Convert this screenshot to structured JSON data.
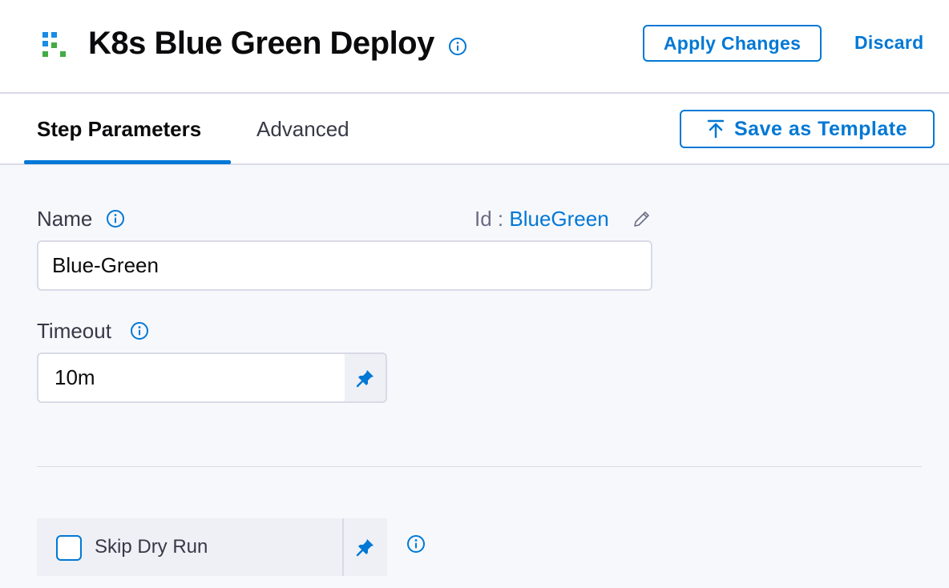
{
  "header": {
    "title": "K8s Blue Green Deploy",
    "apply_label": "Apply Changes",
    "discard_label": "Discard",
    "logo_icon": "k8s-step-logo-icon"
  },
  "tabs": [
    {
      "label": "Step Parameters",
      "active": true
    },
    {
      "label": "Advanced",
      "active": false
    }
  ],
  "template_button": {
    "label": "Save as Template",
    "icon": "upload-icon"
  },
  "form": {
    "name": {
      "label": "Name",
      "value": "Blue-Green"
    },
    "id": {
      "key": "Id :",
      "value": "BlueGreen"
    },
    "timeout": {
      "label": "Timeout",
      "value": "10m"
    },
    "skip_dry_run": {
      "label": "Skip Dry Run",
      "checked": false
    }
  },
  "colors": {
    "accent": "#0278d5",
    "border": "#d9dae6",
    "content_bg": "#f6f8fc",
    "logo_blue": "#1a8ce6",
    "logo_green": "#42ab45"
  }
}
